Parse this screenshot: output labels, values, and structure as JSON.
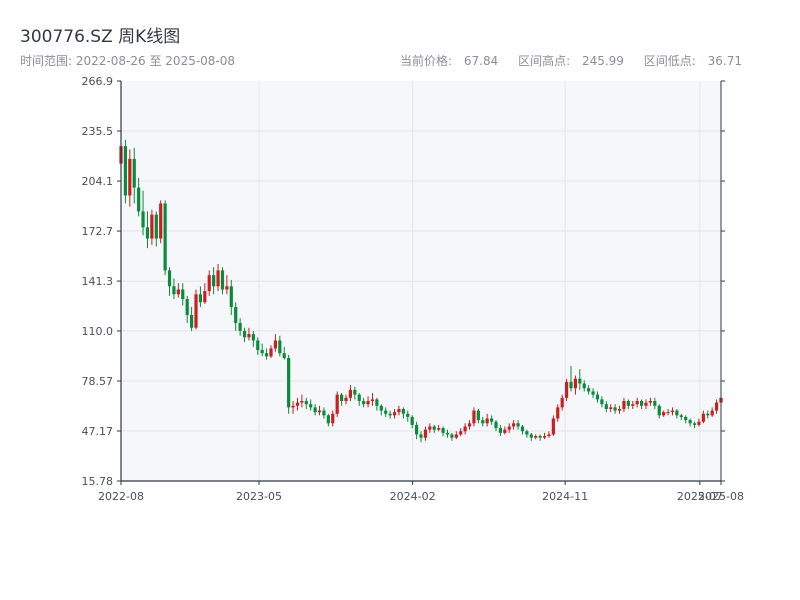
{
  "title": "300776.SZ 周K线图",
  "subtitle": {
    "label": "时间范围:",
    "start": "2022-08-26",
    "sep": "至",
    "end": "2025-08-08"
  },
  "stats": {
    "current_label": "当前价格:",
    "current": "67.84",
    "high_label": "区间高点:",
    "high": "245.99",
    "low_label": "区间低点:",
    "low": "36.71"
  },
  "colors": {
    "up": "#c91f1f",
    "down": "#0a8a3c",
    "plot_bg": "#f6f7fa",
    "grid": "#e3e6ea",
    "axis": "#2f3a44"
  },
  "chart_data": {
    "type": "candlestick",
    "ylim": [
      15.78,
      266.9
    ],
    "y_ticks": [
      "266.9",
      "235.5",
      "204.1",
      "172.7",
      "141.3",
      "110.0",
      "78.57",
      "47.17",
      "15.78"
    ],
    "x_tick_labels": [
      "2022-08",
      "2023-05",
      "2024-02",
      "2024-11",
      "2025-07",
      "2025-08"
    ],
    "x_tick_dates": [
      "2022-08-26",
      "2023-05-01",
      "2024-02-01",
      "2024-11-01",
      "2025-07-01",
      "2025-08-08"
    ],
    "grid": true,
    "first_week": "2022-08-26",
    "last_week": "2025-08-08",
    "candles": [
      [
        215,
        226,
        246,
        212
      ],
      [
        226,
        195,
        230,
        190
      ],
      [
        195,
        218,
        224,
        188
      ],
      [
        218,
        200,
        225,
        190
      ],
      [
        200,
        185,
        206,
        182
      ],
      [
        185,
        175,
        198,
        170
      ],
      [
        175,
        168,
        185,
        162
      ],
      [
        168,
        183,
        186,
        164
      ],
      [
        183,
        168,
        185,
        163
      ],
      [
        168,
        190,
        192,
        165
      ],
      [
        190,
        148,
        192,
        145
      ],
      [
        148,
        138,
        150,
        132
      ],
      [
        138,
        133,
        143,
        130
      ],
      [
        133,
        136,
        140,
        131
      ],
      [
        136,
        130,
        140,
        126
      ],
      [
        130,
        120,
        132,
        115
      ],
      [
        120,
        112,
        125,
        110
      ],
      [
        112,
        133,
        136,
        111
      ],
      [
        133,
        128,
        138,
        125
      ],
      [
        128,
        135,
        140,
        127
      ],
      [
        135,
        145,
        148,
        132
      ],
      [
        145,
        138,
        150,
        133
      ],
      [
        138,
        148,
        152,
        135
      ],
      [
        148,
        136,
        150,
        133
      ],
      [
        136,
        138,
        145,
        133
      ],
      [
        138,
        125,
        142,
        120
      ],
      [
        125,
        115,
        128,
        110
      ],
      [
        115,
        110,
        118,
        107
      ],
      [
        110,
        106,
        112,
        103
      ],
      [
        106,
        108,
        112,
        104
      ],
      [
        108,
        104,
        110,
        100
      ],
      [
        104,
        98,
        106,
        95
      ],
      [
        98,
        96,
        102,
        94
      ],
      [
        96,
        94,
        99,
        92
      ],
      [
        94,
        99,
        101,
        93
      ],
      [
        99,
        104,
        108,
        97
      ],
      [
        104,
        96,
        107,
        94
      ],
      [
        96,
        93,
        100,
        92
      ],
      [
        93,
        62,
        95,
        58
      ],
      [
        62,
        63,
        66,
        58
      ],
      [
        63,
        65,
        68,
        60
      ],
      [
        65,
        66,
        70,
        62
      ],
      [
        66,
        64,
        68,
        61
      ],
      [
        64,
        62,
        67,
        60
      ],
      [
        62,
        59,
        64,
        57
      ],
      [
        59,
        60,
        63,
        57
      ],
      [
        60,
        57,
        62,
        55
      ],
      [
        57,
        52,
        58,
        50
      ],
      [
        52,
        58,
        60,
        50
      ],
      [
        58,
        70,
        72,
        56
      ],
      [
        70,
        66,
        71,
        63
      ],
      [
        66,
        68,
        70,
        64
      ],
      [
        68,
        73,
        76,
        66
      ],
      [
        73,
        70,
        75,
        67
      ],
      [
        70,
        66,
        71,
        63
      ],
      [
        66,
        64,
        68,
        62
      ],
      [
        64,
        66,
        69,
        62
      ],
      [
        66,
        67,
        71,
        63
      ],
      [
        67,
        63,
        68,
        60
      ],
      [
        63,
        60,
        64,
        57
      ],
      [
        60,
        58,
        62,
        56
      ],
      [
        58,
        57,
        60,
        55
      ],
      [
        57,
        59,
        61,
        55
      ],
      [
        59,
        61,
        63,
        57
      ],
      [
        61,
        58,
        62,
        55
      ],
      [
        58,
        56,
        60,
        53
      ],
      [
        56,
        51,
        57,
        49
      ],
      [
        51,
        45,
        53,
        42
      ],
      [
        45,
        43,
        47,
        40
      ],
      [
        43,
        48,
        50,
        41
      ],
      [
        48,
        50,
        52,
        46
      ],
      [
        50,
        48,
        51,
        46
      ],
      [
        48,
        49,
        51,
        47
      ],
      [
        49,
        46,
        50,
        44
      ],
      [
        46,
        45,
        48,
        43
      ],
      [
        45,
        43,
        46,
        41
      ],
      [
        43,
        45,
        47,
        42
      ],
      [
        45,
        47,
        49,
        44
      ],
      [
        47,
        50,
        52,
        45
      ],
      [
        50,
        52,
        54,
        48
      ],
      [
        52,
        60,
        62,
        50
      ],
      [
        60,
        54,
        61,
        52
      ],
      [
        54,
        52,
        56,
        50
      ],
      [
        52,
        55,
        58,
        50
      ],
      [
        55,
        53,
        57,
        51
      ],
      [
        53,
        49,
        54,
        47
      ],
      [
        49,
        46,
        51,
        44
      ],
      [
        46,
        48,
        50,
        45
      ],
      [
        48,
        50,
        52,
        46
      ],
      [
        50,
        52,
        54,
        48
      ],
      [
        52,
        50,
        54,
        48
      ],
      [
        50,
        47,
        51,
        45
      ],
      [
        47,
        45,
        48,
        43
      ],
      [
        45,
        43,
        46,
        41
      ],
      [
        43,
        44,
        45,
        42
      ],
      [
        44,
        43,
        45,
        41
      ],
      [
        43,
        44,
        46,
        42
      ],
      [
        44,
        45,
        47,
        43
      ],
      [
        45,
        55,
        57,
        44
      ],
      [
        55,
        62,
        64,
        53
      ],
      [
        62,
        68,
        70,
        60
      ],
      [
        68,
        78,
        80,
        66
      ],
      [
        78,
        74,
        88,
        72
      ],
      [
        74,
        80,
        82,
        70
      ],
      [
        80,
        77,
        86,
        73
      ],
      [
        77,
        74,
        79,
        72
      ],
      [
        74,
        72,
        76,
        70
      ],
      [
        72,
        70,
        74,
        68
      ],
      [
        70,
        67,
        72,
        65
      ],
      [
        67,
        64,
        69,
        62
      ],
      [
        64,
        61,
        66,
        59
      ],
      [
        61,
        62,
        64,
        59
      ],
      [
        62,
        60,
        64,
        58
      ],
      [
        60,
        61,
        63,
        58
      ],
      [
        61,
        66,
        68,
        59
      ],
      [
        66,
        63,
        67,
        61
      ],
      [
        63,
        64,
        66,
        61
      ],
      [
        64,
        66,
        68,
        62
      ],
      [
        66,
        63,
        67,
        61
      ],
      [
        63,
        65,
        67,
        61
      ],
      [
        65,
        66,
        68,
        63
      ],
      [
        66,
        63,
        68,
        61
      ],
      [
        63,
        57,
        64,
        55
      ],
      [
        57,
        59,
        60,
        56
      ],
      [
        59,
        59,
        61,
        57
      ],
      [
        59,
        60,
        62,
        57
      ],
      [
        60,
        57,
        61,
        55
      ],
      [
        57,
        56,
        58,
        54
      ],
      [
        56,
        54,
        57,
        52
      ],
      [
        54,
        52,
        55,
        50
      ],
      [
        52,
        51,
        53,
        49
      ],
      [
        51,
        53,
        55,
        50
      ],
      [
        53,
        58,
        60,
        52
      ],
      [
        58,
        57,
        60,
        55
      ],
      [
        57,
        60,
        62,
        56
      ],
      [
        60,
        65,
        67,
        58
      ],
      [
        65,
        68,
        70,
        63
      ]
    ]
  }
}
